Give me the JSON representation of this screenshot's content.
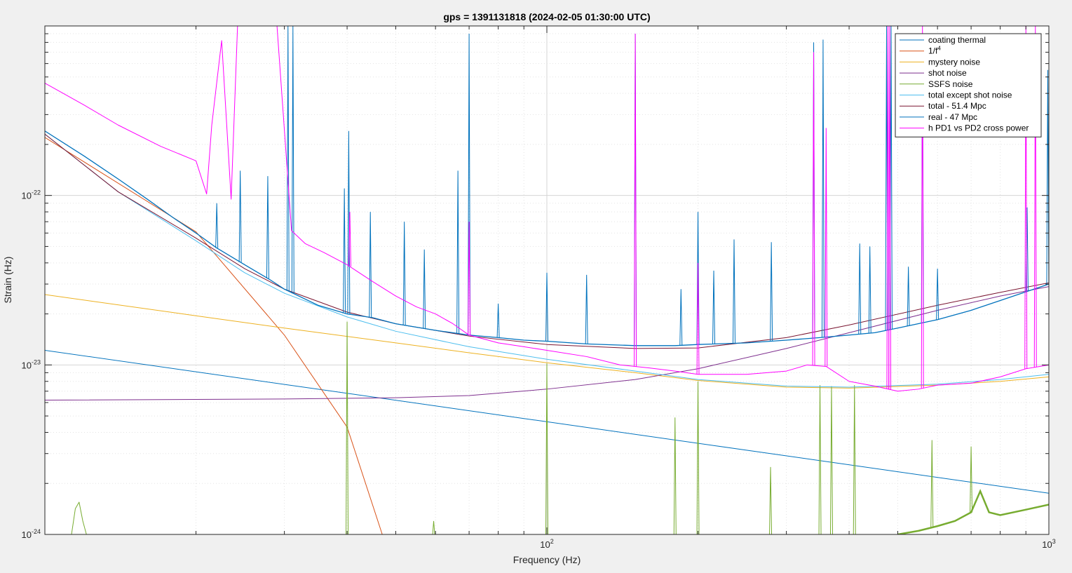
{
  "chart_data": {
    "type": "line",
    "title": "gps = 1391131818 (2024-02-05 01:30:00 UTC)",
    "xlabel": "Frequency (Hz)",
    "ylabel": "Strain (Hz)",
    "xscale": "log",
    "yscale": "log",
    "xlim": [
      10,
      1000
    ],
    "ylim": [
      1e-24,
      1e-21
    ],
    "grid": true,
    "legend_position": "top-right",
    "x_ticks": [
      {
        "value": 100,
        "base": "10",
        "exp": "2"
      },
      {
        "value": 1000,
        "base": "10",
        "exp": "3"
      }
    ],
    "y_ticks": [
      {
        "value": 1e-24,
        "base": "10",
        "exp": "-24"
      },
      {
        "value": 1e-23,
        "base": "10",
        "exp": "-23"
      },
      {
        "value": 1e-22,
        "base": "10",
        "exp": "-22"
      }
    ],
    "series": [
      {
        "name": "coating thermal",
        "color": "#0072bd",
        "width": 1,
        "x": [
          10,
          1000
        ],
        "y": [
          1.22e-23,
          1.75e-24
        ]
      },
      {
        "name": "1/f",
        "name_sup": "4",
        "color": "#d95319",
        "width": 1,
        "x": [
          10,
          20,
          30,
          40,
          47
        ],
        "y": [
          2.2e-22,
          6.1e-23,
          1.5e-23,
          4.3e-24,
          1e-24
        ]
      },
      {
        "name": "mystery noise",
        "color": "#edb120",
        "width": 1,
        "x": [
          10,
          20,
          30,
          50,
          70,
          100,
          150,
          200,
          300,
          400,
          600,
          800,
          1000
        ],
        "y": [
          2.6e-23,
          1.95e-23,
          1.65e-23,
          1.35e-23,
          1.18e-23,
          1.03e-23,
          9e-24,
          8.1e-24,
          7.4e-24,
          7.3e-24,
          7.6e-24,
          8e-24,
          8.5e-24
        ]
      },
      {
        "name": "shot noise",
        "color": "#7e2f8e",
        "width": 1,
        "x": [
          10,
          30,
          50,
          70,
          100,
          150,
          200,
          300,
          400,
          600,
          800,
          1000
        ],
        "y": [
          6.2e-24,
          6.3e-24,
          6.4e-24,
          6.6e-24,
          7.2e-24,
          8.2e-24,
          9.5e-24,
          1.25e-23,
          1.55e-23,
          2.1e-23,
          2.55e-23,
          2.9e-23
        ]
      },
      {
        "name": "SSFS noise",
        "color": "#77ac30",
        "width": 1,
        "x": [
          11.3,
          11.5,
          11.7,
          11.9,
          12.1
        ],
        "y": [
          1e-24,
          1.42e-24,
          1.55e-24,
          1.2e-24,
          1e-24
        ],
        "x2": [
          500,
          550,
          600,
          650,
          700,
          730,
          760,
          800,
          900,
          1000
        ],
        "y2": [
          1e-24,
          1.05e-24,
          1.12e-24,
          1.2e-24,
          1.35e-24,
          1.8e-24,
          1.35e-24,
          1.3e-24,
          1.4e-24,
          1.5e-24
        ],
        "spikes": [
          {
            "x": 40,
            "y": 1.8e-23
          },
          {
            "x": 59.5,
            "y": 1.2e-24
          },
          {
            "x": 100,
            "y": 1.02e-23
          },
          {
            "x": 180,
            "y": 4.9e-24
          },
          {
            "x": 200,
            "y": 8e-24
          },
          {
            "x": 279,
            "y": 2.5e-24
          },
          {
            "x": 350,
            "y": 7.6e-24
          },
          {
            "x": 369,
            "y": 7.5e-24
          },
          {
            "x": 410,
            "y": 7.6e-24
          },
          {
            "x": 585,
            "y": 3.6e-24
          },
          {
            "x": 700,
            "y": 3.3e-24
          }
        ]
      },
      {
        "name": "total except shot noise",
        "color": "#4dbeee",
        "width": 1,
        "x": [
          10,
          14,
          20,
          25,
          30,
          40,
          50,
          70,
          100,
          150,
          200,
          300,
          400,
          600,
          800,
          1000
        ],
        "y": [
          2.3e-22,
          1.05e-22,
          5.4e-23,
          3.5e-23,
          2.65e-23,
          1.92e-23,
          1.58e-23,
          1.28e-23,
          1.08e-23,
          9.2e-24,
          8.2e-24,
          7.5e-24,
          7.4e-24,
          7.7e-24,
          8.2e-24,
          8.8e-24
        ]
      },
      {
        "name": "total - 51.4 Mpc",
        "color": "#7a1531",
        "width": 1,
        "x": [
          10,
          14,
          20,
          25,
          30,
          40,
          50,
          70,
          100,
          150,
          200,
          300,
          400,
          600,
          800,
          1000
        ],
        "y": [
          2.3e-22,
          1.05e-22,
          5.6e-23,
          3.7e-23,
          2.8e-23,
          2.05e-23,
          1.75e-23,
          1.48e-23,
          1.32e-23,
          1.25e-23,
          1.26e-23,
          1.45e-23,
          1.72e-23,
          2.25e-23,
          2.68e-23,
          3.05e-23
        ]
      },
      {
        "name": "real - 47 Mpc",
        "color": "#0072bd",
        "width": 1.3,
        "x": [
          10,
          12,
          14,
          16,
          18,
          20,
          22,
          25,
          28,
          30,
          35,
          40,
          45,
          50,
          60,
          70,
          80,
          90,
          100,
          120,
          150,
          180,
          200,
          250,
          300,
          350,
          400,
          450,
          500,
          600,
          700,
          800,
          900,
          1000
        ],
        "y": [
          2.4e-22,
          1.7e-22,
          1.25e-22,
          9.5e-23,
          7.4e-23,
          6e-23,
          4.9e-23,
          3.9e-23,
          3.2e-23,
          2.8e-23,
          2.25e-23,
          2e-23,
          1.9e-23,
          1.75e-23,
          1.6e-23,
          1.5e-23,
          1.45e-23,
          1.4e-23,
          1.38e-23,
          1.33e-23,
          1.3e-23,
          1.3e-23,
          1.32e-23,
          1.35e-23,
          1.4e-23,
          1.45e-23,
          1.5e-23,
          1.55e-23,
          1.65e-23,
          1.85e-23,
          2.1e-23,
          2.4e-23,
          2.7e-23,
          3e-23
        ],
        "spikes": [
          {
            "x": 22,
            "y": 9e-23
          },
          {
            "x": 24.5,
            "y": 1.4e-22
          },
          {
            "x": 27.8,
            "y": 1.3e-22
          },
          {
            "x": 30.5,
            "y": 1e-21
          },
          {
            "x": 31.2,
            "y": 1e-21
          },
          {
            "x": 39.5,
            "y": 1.1e-22
          },
          {
            "x": 40.3,
            "y": 2.4e-22
          },
          {
            "x": 44.5,
            "y": 8e-23
          },
          {
            "x": 52,
            "y": 7e-23
          },
          {
            "x": 57,
            "y": 4.8e-23
          },
          {
            "x": 66.5,
            "y": 1.4e-22
          },
          {
            "x": 70,
            "y": 9e-22
          },
          {
            "x": 80,
            "y": 2.3e-23
          },
          {
            "x": 100,
            "y": 3.5e-23
          },
          {
            "x": 120,
            "y": 3.4e-23
          },
          {
            "x": 150,
            "y": 9e-22
          },
          {
            "x": 185,
            "y": 2.8e-23
          },
          {
            "x": 200,
            "y": 8e-23
          },
          {
            "x": 215,
            "y": 3.6e-23
          },
          {
            "x": 236,
            "y": 5.5e-23
          },
          {
            "x": 280,
            "y": 5.3e-23
          },
          {
            "x": 340,
            "y": 8e-22
          },
          {
            "x": 355,
            "y": 8.3e-22
          },
          {
            "x": 420,
            "y": 5.2e-23
          },
          {
            "x": 440,
            "y": 5e-23
          },
          {
            "x": 475,
            "y": 1e-21
          },
          {
            "x": 485,
            "y": 1e-21
          },
          {
            "x": 525,
            "y": 3.8e-23
          },
          {
            "x": 560,
            "y": 8e-22
          },
          {
            "x": 600,
            "y": 3.7e-23
          },
          {
            "x": 905,
            "y": 8.5e-23
          },
          {
            "x": 995,
            "y": 5.5e-22
          }
        ]
      },
      {
        "name": "h PD1 vs PD2 cross power",
        "color": "#ff00ff",
        "width": 1,
        "x": [
          10,
          12,
          14,
          17,
          20,
          21,
          21.5,
          22.5,
          23.5,
          24.2,
          26,
          29,
          31,
          33,
          36,
          40,
          45,
          50,
          55,
          60,
          65,
          70,
          80,
          90,
          100,
          120,
          140,
          160,
          180,
          200,
          250,
          300,
          330,
          360,
          400,
          450,
          500,
          550,
          600,
          700,
          800,
          900,
          1000
        ],
        "y": [
          4.6e-22,
          3.4e-22,
          2.6e-22,
          1.95e-22,
          1.6e-22,
          1.02e-22,
          2.6e-22,
          8.2e-22,
          9.5e-23,
          1e-21,
          1e-21,
          1e-21,
          6.2e-23,
          5.2e-23,
          4.6e-23,
          3.9e-23,
          3.1e-23,
          2.55e-23,
          2.2e-23,
          2e-23,
          1.75e-23,
          1.5e-23,
          1.35e-23,
          1.28e-23,
          1.22e-23,
          1.12e-23,
          1e-23,
          9.6e-24,
          9.2e-24,
          8.8e-24,
          8.8e-24,
          9.2e-24,
          1e-23,
          9.8e-24,
          8e-24,
          7.5e-24,
          7e-24,
          7.2e-24,
          7.6e-24,
          7.8e-24,
          8.5e-24,
          9.5e-24,
          1e-23
        ],
        "spikes": [
          {
            "x": 40.5,
            "y": 8e-23
          },
          {
            "x": 70,
            "y": 7e-23
          },
          {
            "x": 150,
            "y": 9e-22
          },
          {
            "x": 200,
            "y": 4e-23
          },
          {
            "x": 340,
            "y": 7e-22
          },
          {
            "x": 360,
            "y": 2.5e-22
          },
          {
            "x": 478,
            "y": 1e-21
          },
          {
            "x": 482,
            "y": 1e-21
          },
          {
            "x": 560,
            "y": 1e-21
          },
          {
            "x": 900,
            "y": 1e-21
          },
          {
            "x": 940,
            "y": 1e-21
          }
        ]
      }
    ]
  }
}
